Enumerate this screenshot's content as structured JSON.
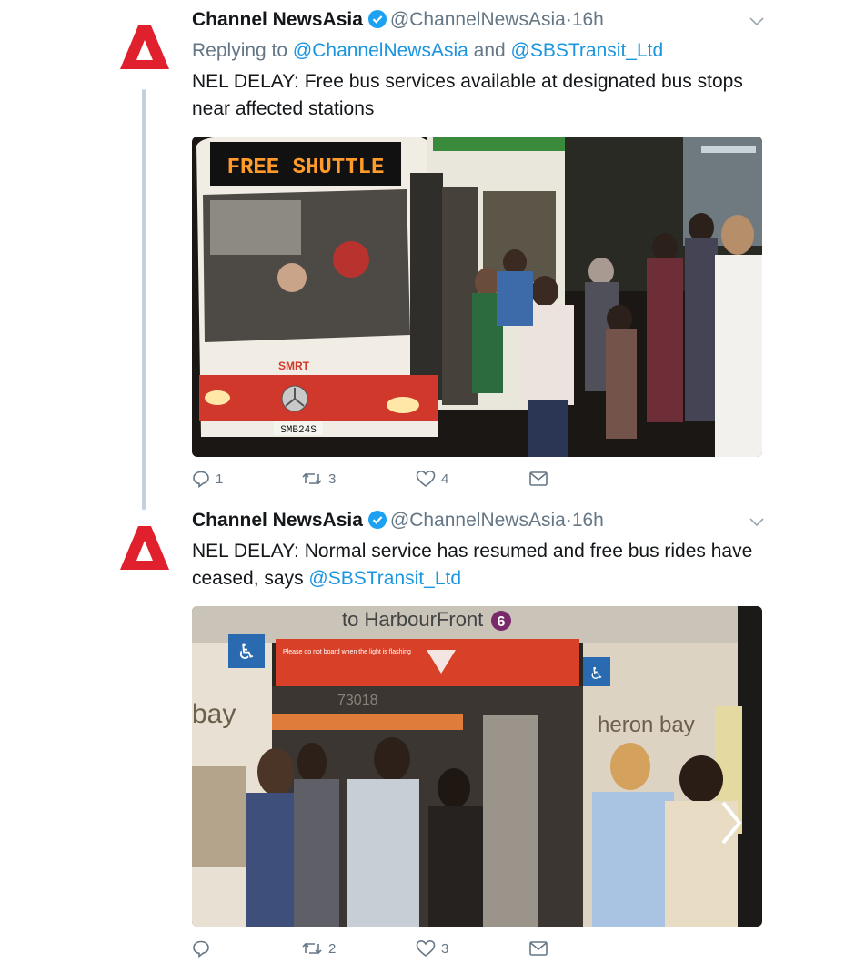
{
  "tweets": [
    {
      "author": "Channel NewsAsia",
      "handle": "@ChannelNewsAsia",
      "separator": "·",
      "time": "16h",
      "replying_prefix": "Replying to ",
      "replying_to_1": "@ChannelNewsAsia",
      "replying_and": " and ",
      "replying_to_2": "@SBSTransit_Ltd",
      "text": "NEL DELAY: Free bus services available at designated bus stops near affected stations",
      "media_caption": "FREE SHUTTLE",
      "bus_brand": "SMRT",
      "plate": "SMB24S",
      "replies": "1",
      "retweets": "3",
      "likes": "4"
    },
    {
      "author": "Channel NewsAsia",
      "handle": "@ChannelNewsAsia",
      "separator": "·",
      "time": "16h",
      "text_prefix": "NEL DELAY: Normal service has resumed and free bus rides have ceased, says ",
      "text_mention": "@SBSTransit_Ltd",
      "sign_text": "to HarbourFront",
      "sign_number": "6",
      "warning_text": "Please do not board when the light is flashing",
      "train_number": "73018",
      "ad_left": "bay",
      "ad_right": "heron bay",
      "replies": "",
      "retweets": "2",
      "likes": "3"
    }
  ],
  "colors": {
    "brand_red": "#e0202d",
    "link_blue": "#1b95e0",
    "meta_gray": "#657786",
    "verified_blue": "#1da1f2"
  },
  "icons": [
    "cna-logo-icon",
    "verified-icon",
    "chevron-down-icon",
    "reply-icon",
    "retweet-icon",
    "like-icon",
    "dm-icon",
    "next-image-icon"
  ]
}
